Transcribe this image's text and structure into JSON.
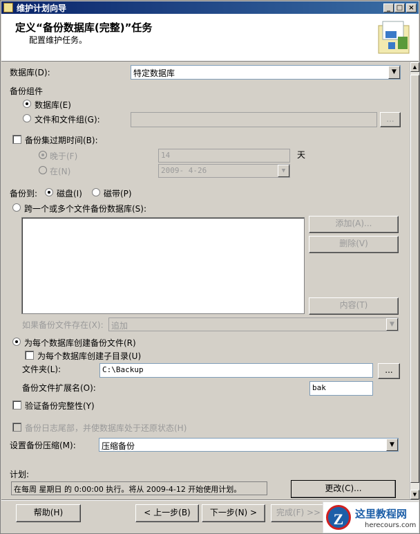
{
  "window": {
    "title": "维护计划向导",
    "controls": [
      "_",
      "□",
      "×"
    ]
  },
  "header": {
    "title": "定义“备份数据库(完整)”任务",
    "subtitle": "配置维护任务。",
    "graphic_icon": "wizard-graphic-icon"
  },
  "database": {
    "label": "数据库(D):",
    "value": "特定数据库"
  },
  "backup_component": {
    "label": "备份组件",
    "option_database": "数据库(E)",
    "option_files": "文件和文件组(G):",
    "browse_label": "..."
  },
  "expiry": {
    "label": "备份集过期时间(B):",
    "after_label": "晚于(F)",
    "after_value": "14",
    "unit": "天",
    "on_label": "在(N)",
    "on_value": "2009- 4-26"
  },
  "backup_to": {
    "label": "备份到:",
    "disk": "磁盘(I)",
    "tape": "磁带(P)"
  },
  "span": {
    "label": "跨一个或多个文件备份数据库(S):",
    "add": "添加(A)...",
    "remove": "删除(V)",
    "contents": "内容(T)",
    "if_exists_label": "如果备份文件存在(X):",
    "if_exists_value": "追加"
  },
  "per_db": {
    "label": "为每个数据库创建备份文件(R)",
    "subdir_label": "为每个数据库创建子目录(U)",
    "folder_label": "文件夹(L):",
    "folder_value": "C:\\Backup",
    "folder_browse": "...",
    "ext_label": "备份文件扩展名(O):",
    "ext_value": "bak"
  },
  "verify": {
    "label": "验证备份完整性(Y)"
  },
  "tail_log": {
    "label": "备份日志尾部，并使数据库处于还原状态(H)"
  },
  "compression": {
    "label": "设置备份压缩(M):",
    "value": "压缩备份"
  },
  "schedule": {
    "label": "计划:",
    "value": "在每周 星期日 的 0:00:00 执行。将从 2009-4-12 开始使用计划。",
    "change": "更改(C)..."
  },
  "footer": {
    "help": "帮助(H)",
    "back": "< 上一步(B)",
    "next": "下一步(N) >",
    "finish": "完成(F) >>"
  },
  "watermark": {
    "logo_letter": "Z",
    "title": "这里教程网",
    "url": "herecours.com"
  },
  "colors": {
    "titlebar_start": "#0a246a",
    "titlebar_end": "#3a6ea5",
    "dialog_bg": "#d4d0c8",
    "disabled_text": "#9a9a9a"
  }
}
